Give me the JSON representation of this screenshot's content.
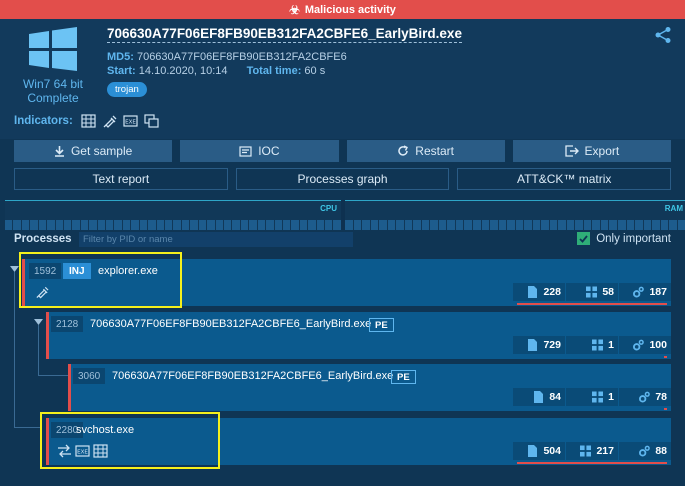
{
  "alert": {
    "text": "Malicious activity",
    "color": "#e24e4b"
  },
  "os": {
    "name": "Win7 64 bit",
    "status": "Complete"
  },
  "task": {
    "filename": "706630A77F06EF8FB90EB312FA2CBFE6_EarlyBird.exe",
    "md5_label": "MD5:",
    "md5": "706630A77F06EF8FB90EB312FA2CBFE6",
    "start_label": "Start:",
    "start": "14.10.2020, 10:14",
    "total_label": "Total time:",
    "total": "60 s",
    "tag": "trojan"
  },
  "indicators": {
    "label": "Indicators:",
    "icons": [
      "network-icon",
      "injection-icon",
      "executable-icon",
      "multi-window-icon"
    ]
  },
  "buttons_row1": [
    {
      "label": "Get sample",
      "icon": "download-icon"
    },
    {
      "label": "IOC",
      "icon": "ioc-icon"
    },
    {
      "label": "Restart",
      "icon": "restart-icon"
    },
    {
      "label": "Export",
      "icon": "export-icon"
    }
  ],
  "buttons_row2": [
    {
      "label": "Text report"
    },
    {
      "label": "Processes graph"
    },
    {
      "label": "ATT&CK™ matrix"
    }
  ],
  "graphs": {
    "cpu_label": "CPU",
    "ram_label": "RAM"
  },
  "processes": {
    "title": "Processes",
    "filter_placeholder": "Filter by PID or name",
    "only_important_label": "Only important",
    "only_important_checked": true,
    "items": [
      {
        "pid": "1592",
        "name": "explorer.exe",
        "tag": "INJ",
        "files": "228",
        "registry": "58",
        "modules": "187",
        "files_bar": 1.0
      },
      {
        "pid": "2128",
        "name": "706630A77F06EF8FB90EB312FA2CBFE6_EarlyBird.exe",
        "tag": "PE",
        "files": "729",
        "registry": "1",
        "modules": "100",
        "files_bar": 0.02
      },
      {
        "pid": "3060",
        "name": "706630A77F06EF8FB90EB312FA2CBFE6_EarlyBird.exe",
        "tag": "PE",
        "files": "84",
        "registry": "1",
        "modules": "78",
        "files_bar": 0.01
      },
      {
        "pid": "2280",
        "name": "svchost.exe",
        "tag": "",
        "files": "504",
        "registry": "217",
        "modules": "88",
        "files_bar": 1.0
      }
    ]
  },
  "colors": {
    "accent": "#2b8fd6",
    "danger": "#e24e4b",
    "highlight": "#f5f01c",
    "ok": "#2fae78"
  }
}
